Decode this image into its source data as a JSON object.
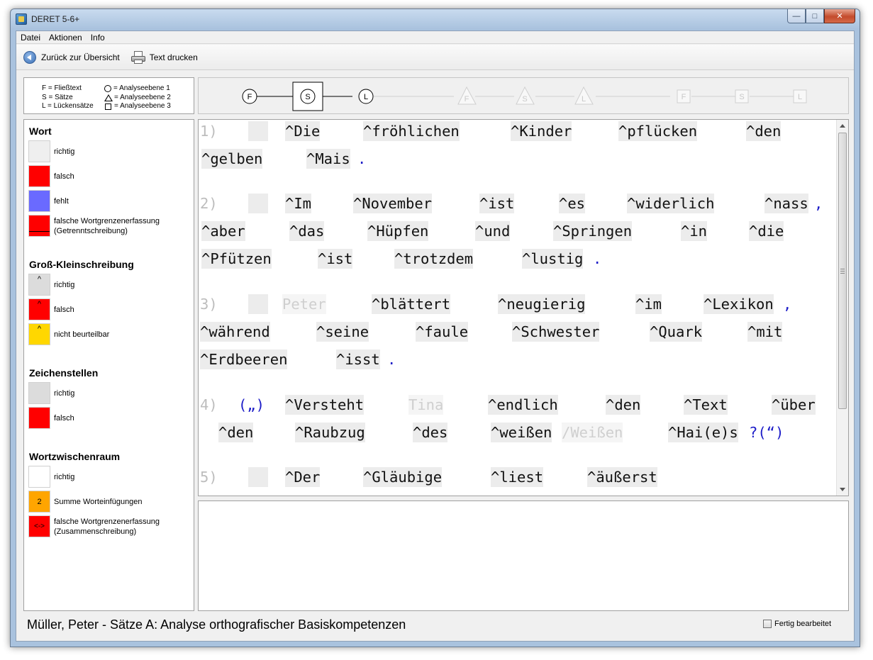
{
  "window": {
    "title": "DERET 5-6+"
  },
  "menu": [
    "Datei",
    "Aktionen",
    "Info"
  ],
  "toolbar": {
    "back_label": "Zurück zur Übersicht",
    "print_label": "Text drucken"
  },
  "legend": {
    "left": [
      "F = Fließtext",
      "S = Sätze",
      "L = Lückensätze"
    ],
    "right": [
      "= Analyseebene 1",
      "= Analyseebene 2",
      "= Analyseebene 3"
    ]
  },
  "levels": {
    "level1": [
      "F",
      "S",
      "L"
    ],
    "level2": [
      "F",
      "S",
      "L"
    ],
    "level3": [
      "F",
      "S",
      "L"
    ],
    "active": "S"
  },
  "categories": {
    "wort": {
      "title": "Wort",
      "items": [
        {
          "label": "richtig",
          "color": "#efefef",
          "mark": ""
        },
        {
          "label": "falsch",
          "color": "#ff0000",
          "mark": ""
        },
        {
          "label": "fehlt",
          "color": "#6a6aff",
          "mark": ""
        },
        {
          "label": "falsche Wortgrenzenerfassung (Getrenntschreibung)",
          "color": "#ff0000",
          "mark": ""
        }
      ]
    },
    "gross": {
      "title": "Groß-Kleinschreibung",
      "items": [
        {
          "label": "richtig",
          "color": "#dcdcdc",
          "mark": "^"
        },
        {
          "label": "falsch",
          "color": "#ff0000",
          "mark": "^"
        },
        {
          "label": "nicht beurteilbar",
          "color": "#ffd700",
          "mark": "^"
        }
      ]
    },
    "zeichen": {
      "title": "Zeichenstellen",
      "items": [
        {
          "label": "richtig",
          "color": "#dcdcdc",
          "mark": ""
        },
        {
          "label": "falsch",
          "color": "#ff0000",
          "mark": ""
        }
      ]
    },
    "zwischen": {
      "title": "Wortzwischenraum",
      "items": [
        {
          "label": "richtig",
          "color": "#ffffff",
          "mark": ""
        },
        {
          "label": "Summe Worteinfügungen",
          "color": "#ffa500",
          "mark": "2"
        },
        {
          "label": "falsche Wortgrenzenerfassung (Zusammenschreibung)",
          "color": "#ff0000",
          "mark": "<->"
        }
      ]
    }
  },
  "sentences": [
    {
      "lines": [
        [
          "1)",
          "",
          "^Die",
          "^fröhlichen",
          "^Kinder",
          "^pflücken",
          "^den"
        ],
        [
          "^gelben",
          "^Mais",
          "."
        ]
      ]
    },
    {
      "lines": [
        [
          "2)",
          "",
          "^Im",
          "^November",
          "^ist",
          "^es",
          "^widerlich",
          "^nass",
          ","
        ],
        [
          "^aber",
          "^das",
          "^Hüpfen",
          "^und",
          "^Springen",
          "^in",
          "^die"
        ],
        [
          "^Pfützen",
          "^ist",
          "^trotzdem",
          "^lustig",
          "."
        ]
      ]
    },
    {
      "lines": [
        [
          "3)",
          "",
          "Peter",
          "^blättert",
          "^neugierig",
          "^im",
          "^Lexikon",
          ","
        ],
        [
          "^während",
          "^seine",
          "^faule",
          "^Schwester",
          "^Quark",
          "^mit"
        ],
        [
          "^Erdbeeren",
          "^isst",
          "."
        ]
      ]
    },
    {
      "lines": [
        [
          "4)",
          "(„)",
          "^Versteht",
          "Tina",
          "^endlich",
          "^den",
          "^Text",
          "^über"
        ],
        [
          "^den",
          "^Raubzug",
          "^des",
          "^weißen",
          "/Weißen",
          "^Hai(e)s",
          "?(“)"
        ]
      ]
    },
    {
      "lines": [
        [
          "5)",
          "",
          "^Der",
          "^Gläubige",
          "^liest",
          "^äußerst"
        ]
      ]
    }
  ],
  "status": {
    "text": "Müller, Peter -  Sätze A:  Analyse orthografischer Basiskompetenzen",
    "done_label": "Fertig bearbeitet"
  }
}
